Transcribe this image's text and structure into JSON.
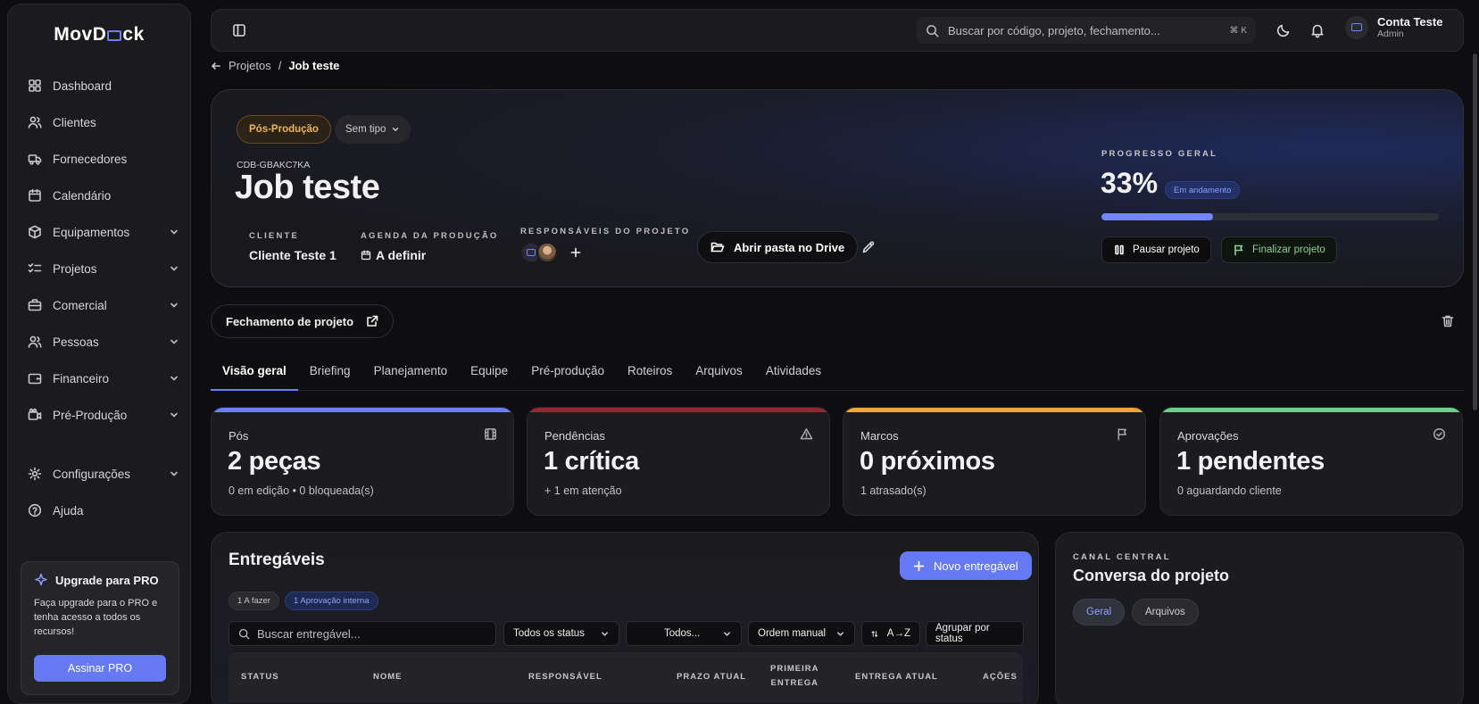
{
  "app": {
    "logo_left": "MovD",
    "logo_right": "ck"
  },
  "sidebar": {
    "items": [
      {
        "label": "Dashboard",
        "icon": "grid-icon"
      },
      {
        "label": "Clientes",
        "icon": "users-icon"
      },
      {
        "label": "Fornecedores",
        "icon": "truck-icon"
      },
      {
        "label": "Calendário",
        "icon": "calendar-icon"
      },
      {
        "label": "Equipamentos",
        "icon": "box-icon"
      },
      {
        "label": "Projetos",
        "icon": "list-check-icon"
      },
      {
        "label": "Comercial",
        "icon": "briefcase-icon"
      },
      {
        "label": "Pessoas",
        "icon": "people-icon"
      },
      {
        "label": "Financeiro",
        "icon": "wallet-icon"
      },
      {
        "label": "Pré-Produção",
        "icon": "camera-icon"
      },
      {
        "label": "Configurações",
        "icon": "gear-icon"
      },
      {
        "label": "Ajuda",
        "icon": "help-icon"
      }
    ],
    "upgrade": {
      "title": "Upgrade para PRO",
      "description": "Faça upgrade para o PRO e tenha acesso a todos os recursos!",
      "button": "Assinar PRO"
    }
  },
  "topbar": {
    "search_placeholder": "Buscar por código, projeto, fechamento...",
    "shortcut": "⌘ K",
    "account_name": "Conta Teste",
    "account_role": "Admin"
  },
  "breadcrumb": {
    "parent": "Projetos",
    "separator": "/",
    "current": "Job teste"
  },
  "project": {
    "stage_badge": "Pós-Produção",
    "type": "Sem tipo",
    "code": "CDB-GBAKC7KA",
    "title": "Job teste",
    "client_label": "CLIENTE",
    "client": "Cliente Teste 1",
    "agenda_label": "AGENDA DA PRODUÇÃO",
    "agenda": "A definir",
    "responsaveis_label": "RESPONSÁVEIS DO PROJETO",
    "drive_button": "Abrir pasta no Drive",
    "progress_label": "PROGRESSO GERAL",
    "progress_text": "33%",
    "progress_value": 33,
    "progress_status": "Em andamento",
    "pause_button": "Pausar projeto",
    "finish_button": "Finalizar projeto",
    "closing_button": "Fechamento de projeto"
  },
  "tabs": [
    "Visão geral",
    "Briefing",
    "Planejamento",
    "Equipe",
    "Pré-produção",
    "Roteiros",
    "Arquivos",
    "Atividades"
  ],
  "stats": [
    {
      "label": "Pós",
      "value": "2 peças",
      "sub": "0 em edição  •  0 bloqueada(s)",
      "color": "#6b7fff",
      "icon": "film-icon"
    },
    {
      "label": "Pendências",
      "value": "1 crítica",
      "sub": "+ 1 em atenção",
      "color": "#8f2a30",
      "icon": "alert-icon"
    },
    {
      "label": "Marcos",
      "value": "0 próximos",
      "sub": "1 atrasado(s)",
      "color": "#f0a63b",
      "icon": "flag-icon"
    },
    {
      "label": "Aprovações",
      "value": "1 pendentes",
      "sub": "0 aguardando cliente",
      "color": "#6fcf8a",
      "icon": "check-circle-icon"
    }
  ],
  "entregaveis": {
    "title": "Entregáveis",
    "new_button": "Novo entregável",
    "chip_todo": "1 A fazer",
    "chip_approval": "1 Aprovação interna",
    "search_placeholder": "Buscar entregável...",
    "filter_status": "Todos os status",
    "filter_people": "Todos...",
    "order": "Ordem manual",
    "sort": "A→Z",
    "group": "Agrupar por status",
    "columns": {
      "status": "STATUS",
      "nome": "NOME",
      "responsavel": "RESPONSÁVEL",
      "prazo": "PRAZO ATUAL",
      "primeira_1": "PRIMEIRA",
      "primeira_2": "ENTREGA",
      "entrega": "ENTREGA ATUAL",
      "acoes": "AÇÕES"
    }
  },
  "canal": {
    "label": "CANAL CENTRAL",
    "title": "Conversa do projeto",
    "tab_geral": "Geral",
    "tab_arquivos": "Arquivos"
  }
}
